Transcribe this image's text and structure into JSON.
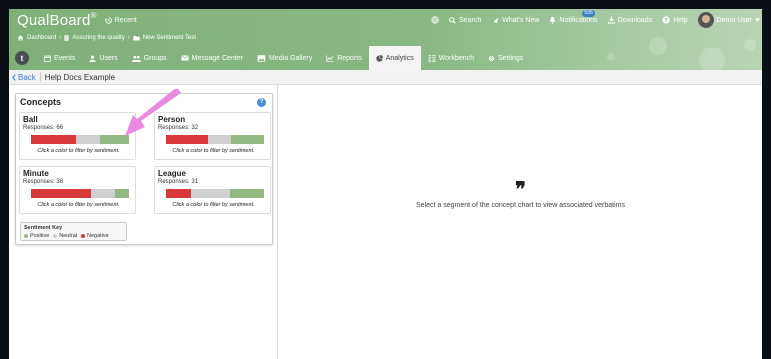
{
  "app": {
    "logo": "QualBoard",
    "logo_reg": "®",
    "recent": "Recent"
  },
  "topnav": {
    "search": "Search",
    "whats_new": "What's New",
    "notifications": "Notifications",
    "notifications_count": "535",
    "downloads": "Downloads",
    "help": "Help",
    "user": "Demo User"
  },
  "breadcrumb": {
    "dashboard": "Dashboard",
    "project": "Assuring the quality",
    "folder": "New Sentiment Test"
  },
  "tabs": {
    "events": "Events",
    "users": "Users",
    "groups": "Groups",
    "message_center": "Message Center",
    "media_gallery": "Media Gallery",
    "reports": "Reports",
    "analytics": "Analytics",
    "workbench": "Workbench",
    "settings": "Settings"
  },
  "subbar": {
    "back": "Back",
    "title": "Help Docs Example"
  },
  "concepts": {
    "title": "Concepts",
    "hint": "Click a color to filter by sentiment.",
    "items": [
      {
        "name": "Ball",
        "responses": "Responses: 66",
        "negative": 0.46,
        "neutral": 0.24,
        "positive": 0.3
      },
      {
        "name": "Person",
        "responses": "Responses: 32",
        "negative": 0.43,
        "neutral": 0.23,
        "positive": 0.34
      },
      {
        "name": "Minute",
        "responses": "Responses: 38",
        "negative": 0.61,
        "neutral": 0.25,
        "positive": 0.14
      },
      {
        "name": "League",
        "responses": "Responses: 31",
        "negative": 0.26,
        "neutral": 0.39,
        "positive": 0.35
      }
    ],
    "key": {
      "title": "Sentiment Key",
      "positive": "Positive",
      "neutral": "Neutral",
      "negative": "Negative"
    }
  },
  "colors": {
    "positive": "#93b882",
    "neutral": "#cfcfcf",
    "negative": "#d9383b",
    "arrow": "#e98be0",
    "accent": "#3d7fc6"
  },
  "verbatims": {
    "icon": "quote-icon",
    "quote_glyph": "❞",
    "message": "Select a segment of the concept chart to view associated verbatims"
  }
}
